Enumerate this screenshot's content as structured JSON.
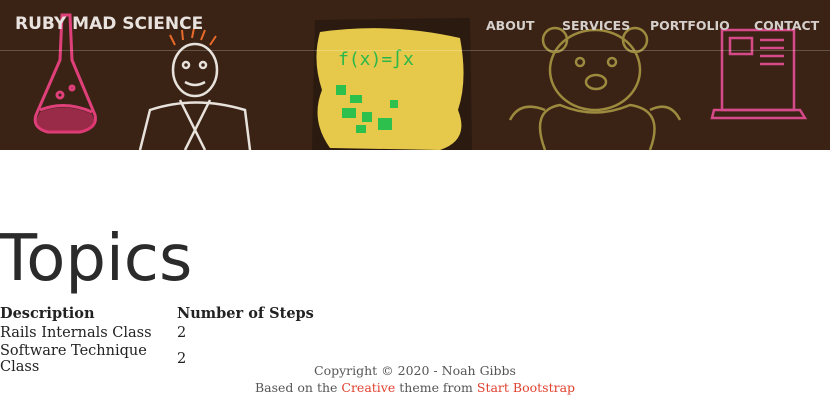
{
  "header": {
    "brand": "RUBY MAD SCIENCE",
    "nav": [
      {
        "label": "ABOUT"
      },
      {
        "label": "SERVICES"
      },
      {
        "label": "PORTFOLIO"
      },
      {
        "label": "CONTACT"
      }
    ],
    "banner_text": "f(x)=∫x",
    "colors": {
      "banner_bg": "#3a2214",
      "accent": "#e0412e"
    }
  },
  "main": {
    "title": "Topics",
    "table": {
      "headers": [
        "Description",
        "Number of Steps"
      ],
      "rows": [
        [
          "Rails Internals Class",
          "2"
        ],
        [
          "Software Technique Class",
          "2"
        ]
      ]
    }
  },
  "footer": {
    "line1": "Copyright © 2020 - Noah Gibbs",
    "prefix": "Based on the ",
    "link1": "Creative",
    "middle": " theme from ",
    "link2": "Start Bootstrap"
  }
}
